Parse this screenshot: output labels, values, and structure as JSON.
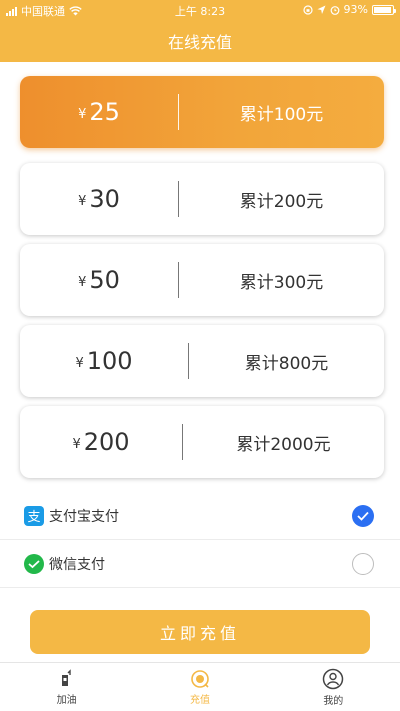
{
  "status_bar": {
    "carrier": "中国联通",
    "time": "上午 8:23",
    "battery": "93%",
    "battery_level": 0.93
  },
  "header": {
    "title": "在线充值"
  },
  "currency_symbol": "¥",
  "options": [
    {
      "amount": "25",
      "total": "累计100元",
      "selected": true
    },
    {
      "amount": "30",
      "total": "累计200元",
      "selected": false
    },
    {
      "amount": "50",
      "total": "累计300元",
      "selected": false
    },
    {
      "amount": "100",
      "total": "累计800元",
      "selected": false
    },
    {
      "amount": "200",
      "total": "累计2000元",
      "selected": false
    }
  ],
  "payment": {
    "methods": [
      {
        "label": "支付宝支付",
        "icon": "alipay-icon",
        "checked": true
      },
      {
        "label": "微信支付",
        "icon": "wechat-icon",
        "checked": false
      }
    ]
  },
  "submit_label": "立即充值",
  "tabbar": {
    "tabs": [
      {
        "label": "加油",
        "icon": "fuel-icon",
        "active": false
      },
      {
        "label": "充值",
        "icon": "recharge-icon",
        "active": true
      },
      {
        "label": "我的",
        "icon": "profile-icon",
        "active": false
      }
    ]
  },
  "colors": {
    "accent": "#f4b845",
    "selected_gradient_start": "#ee8f2d",
    "check_blue": "#2b6ff2"
  }
}
